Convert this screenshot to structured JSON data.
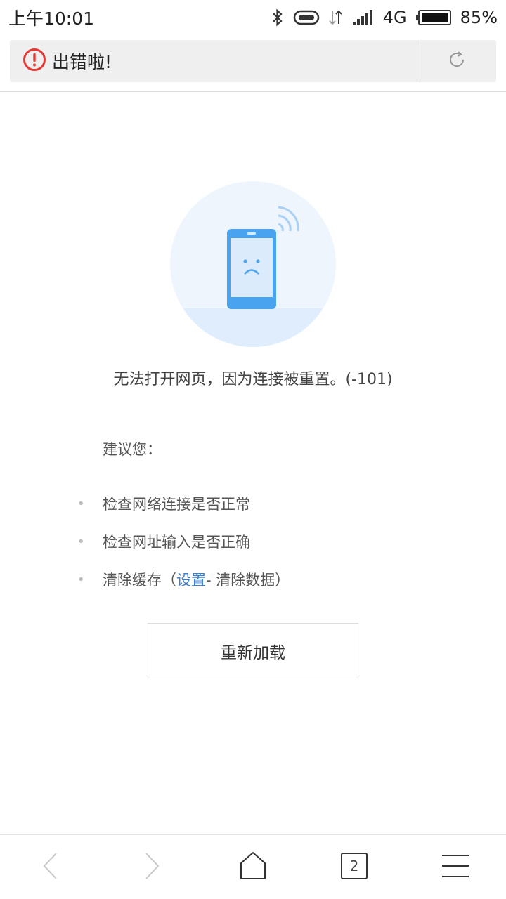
{
  "status_bar": {
    "time": "上午10:01",
    "network": "4G",
    "battery": "85%"
  },
  "address_bar": {
    "title": "出错啦!"
  },
  "error": {
    "message": "无法打开网页，因为连接被重置。(-101)"
  },
  "suggestions": {
    "title": "建议您：",
    "items": [
      "检查网络连接是否正常",
      "检查网址输入是否正确"
    ],
    "clear_cache_prefix": "清除缓存（",
    "clear_cache_link": "设置",
    "clear_cache_suffix": " - 清除数据）"
  },
  "reload_button": {
    "label": "重新加载"
  },
  "bottom_nav": {
    "tab_count": "2"
  },
  "colors": {
    "accent_link": "#3a7fd0",
    "error_red": "#e53935",
    "illustration_blue": "#4aa3ee"
  }
}
